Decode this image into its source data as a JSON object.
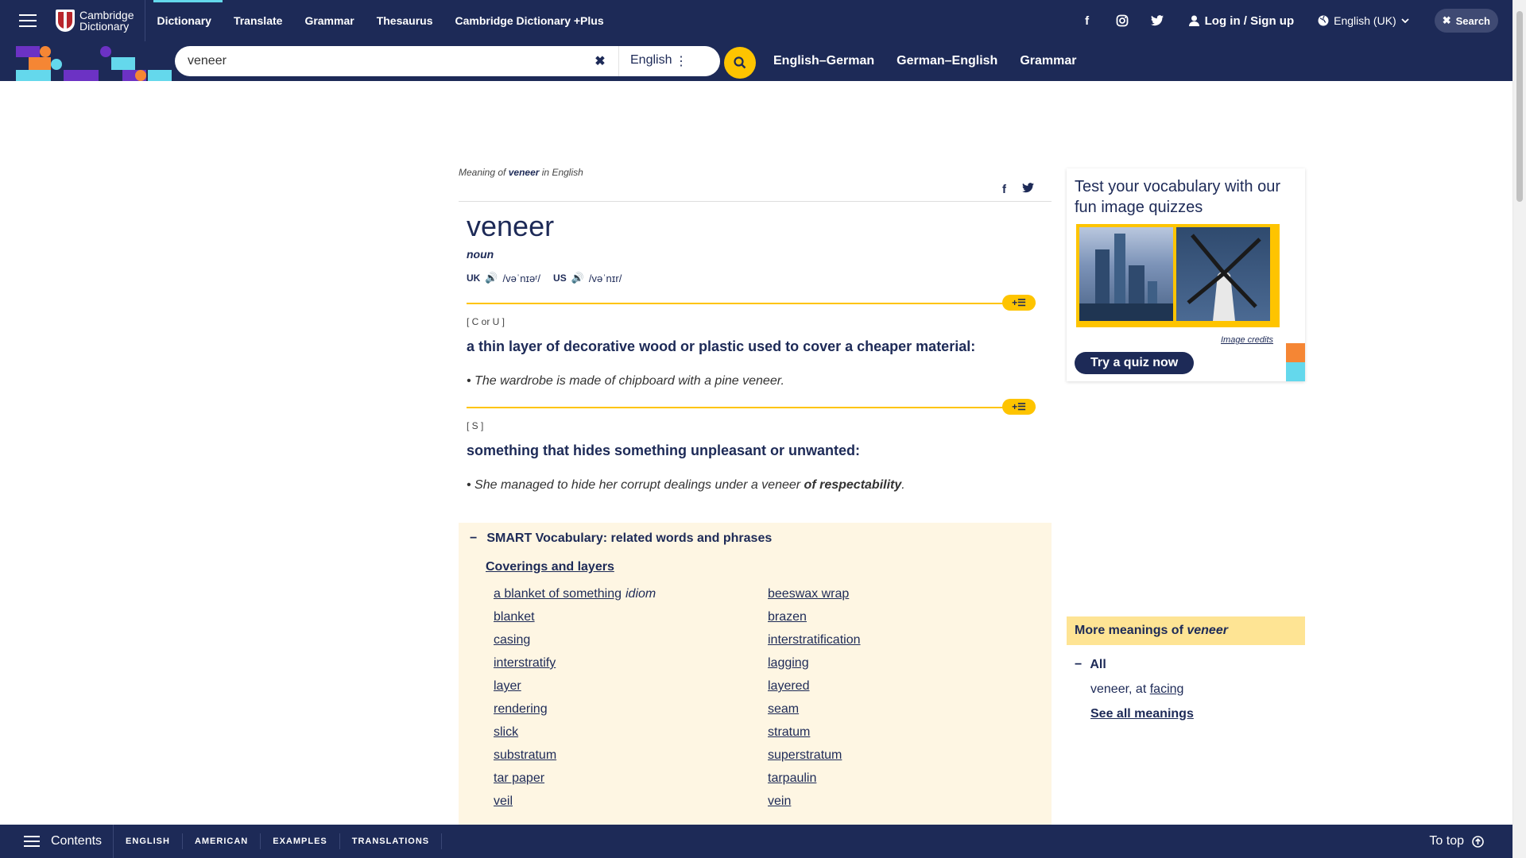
{
  "header": {
    "logo_text_line1": "Cambridge",
    "logo_text_line2": "Dictionary",
    "nav": [
      "Dictionary",
      "Translate",
      "Grammar",
      "Thesaurus",
      "Cambridge Dictionary +Plus"
    ],
    "social": {
      "facebook": "f",
      "instagram": "◎",
      "twitter": "🐦"
    },
    "login_label": "Log in / Sign up",
    "language_label": "English (UK)",
    "search_label": "Search"
  },
  "search": {
    "value": "veneer",
    "source_language": "English",
    "links": [
      "English–German",
      "German–English",
      "Grammar"
    ]
  },
  "entry": {
    "breadcrumb_prefix": "Meaning of",
    "breadcrumb_word": "veneer",
    "breadcrumb_suffix": "in English",
    "headword": "veneer",
    "pos": "noun",
    "uk_label": "UK",
    "uk_ipa": "/vəˈnɪəʳ/",
    "us_label": "US",
    "us_ipa": "/vəˈnɪr/",
    "add_label": "+☰",
    "senses": [
      {
        "grammar": "[ C or U ]",
        "definition": "a thin layer of decorative wood or plastic used to cover a cheaper material:",
        "example": "The wardrobe is made of chipboard with a pine veneer."
      },
      {
        "grammar": "[ S ]",
        "definition": "something that hides something unpleasant or unwanted:",
        "example_start": "She managed to hide her corrupt dealings under a veneer ",
        "example_bold": "of respectability",
        "example_end": "."
      }
    ]
  },
  "smart_vocab": {
    "heading": "SMART Vocabulary: related words and phrases",
    "category": "Coverings and layers",
    "left": [
      "a blanket of something",
      "blanket",
      "casing",
      "interstratify",
      "layer",
      "rendering",
      "slick",
      "substratum",
      "tar paper",
      "veil"
    ],
    "left_first_tag": "idiom",
    "right": [
      "beeswax wrap",
      "brazen",
      "interstratification",
      "lagging",
      "layered",
      "seam",
      "stratum",
      "superstratum",
      "tarpaulin",
      "vein"
    ]
  },
  "quiz": {
    "title": "Test your vocabulary with our fun image quizzes",
    "credits": "Image credits",
    "button": "Try a quiz now"
  },
  "more_meanings": {
    "heading_prefix": "More meanings of",
    "heading_word": "veneer",
    "all_label": "All",
    "item_prefix": "veneer, at",
    "item_link": "facing",
    "see_all": "See all meanings"
  },
  "bottom": {
    "contents": "Contents",
    "links": [
      "ENGLISH",
      "AMERICAN",
      "EXAMPLES",
      "TRANSLATIONS"
    ],
    "to_top": "To top"
  },
  "colors": {
    "brand_navy": "#1d2a57",
    "accent_yellow": "#fec400",
    "accent_cyan": "#64d8ec",
    "accent_orange": "#f58634",
    "accent_purple": "#6c32c4",
    "smart_bg": "#fef6e3"
  }
}
